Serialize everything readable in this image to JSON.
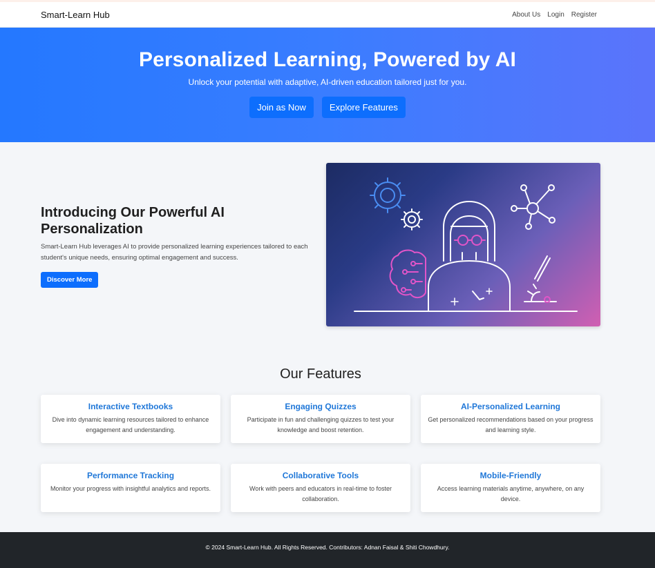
{
  "nav": {
    "brand": "Smart-Learn Hub",
    "links": [
      "About Us",
      "Login",
      "Register"
    ]
  },
  "hero": {
    "title": "Personalized Learning, Powered by AI",
    "subtitle": "Unlock your potential with adaptive, AI-driven education tailored just for you.",
    "buttons": [
      "Join as Now",
      "Explore Features"
    ]
  },
  "intro": {
    "heading": "Introducing Our Powerful AI Personalization",
    "body": "Smart-Learn Hub leverages AI to provide personalized learning experiences tailored to each student's unique needs, ensuring optimal engagement and success.",
    "button": "Discover More"
  },
  "features": {
    "heading": "Our Features",
    "cards": [
      {
        "title": "Interactive Textbooks",
        "text": "Dive into dynamic learning resources tailored to enhance engagement and understanding."
      },
      {
        "title": "Engaging Quizzes",
        "text": "Participate in fun and challenging quizzes to test your knowledge and boost retention."
      },
      {
        "title": "AI-Personalized Learning",
        "text": "Get personalized recommendations based on your progress and learning style."
      },
      {
        "title": "Performance Tracking",
        "text": "Monitor your progress with insightful analytics and reports."
      },
      {
        "title": "Collaborative Tools",
        "text": "Work with peers and educators in real-time to foster collaboration."
      },
      {
        "title": "Mobile-Friendly",
        "text": "Access learning materials anytime, anywhere, on any device."
      }
    ]
  },
  "footer": {
    "text": "© 2024 Smart-Learn Hub. All Rights Reserved. Contributors: Adnan Faisal & Shiti Chowdhury."
  },
  "colors": {
    "primary": "#0d6efd",
    "card_title": "#1f77d8",
    "footer_bg": "#212529"
  }
}
